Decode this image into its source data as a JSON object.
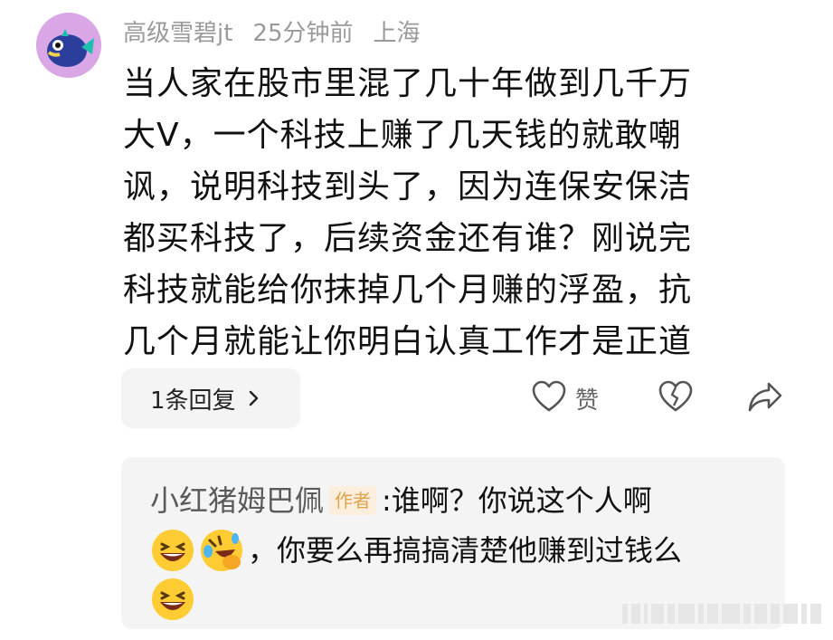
{
  "comment": {
    "username": "高级雪碧jt",
    "time": "25分钟前",
    "location": "上海",
    "lines": [
      "当人家在股市里混了几十年做到几千万",
      "大V，一个科技上赚了几天钱的就敢嘲",
      "讽，说明科技到头了，因为连保安保洁",
      "都买科技了，后续资金还有谁？刚说完",
      "科技就能给你抹掉几个月赚的浮盈，抗",
      "几个月就能让你明白认真工作才是正道"
    ],
    "replies_label": "1条回复",
    "like_label": "赞",
    "icons": {
      "avatar": "pufferfish-avatar",
      "chevron": "chevron-right-icon",
      "like": "heart-icon",
      "dislike": "broken-heart-icon",
      "share": "share-arrow-icon"
    }
  },
  "reply": {
    "author": "小红猪姆巴佩",
    "author_badge": "作者",
    "line1": ":谁啊？你说这个人啊",
    "line2": "，你要么再搞搞清楚他赚到过钱么",
    "emojis": [
      "grinning-face-emoji",
      "rolling-laughing-emoji",
      "grinning-face-emoji"
    ]
  },
  "colors": {
    "meta": "#9a9a9a",
    "reply_bg": "#f4f4f4",
    "badge_text": "#e0a24a",
    "badge_bg": "#fbeedd",
    "avatar_bg": "#d9a6e6"
  }
}
